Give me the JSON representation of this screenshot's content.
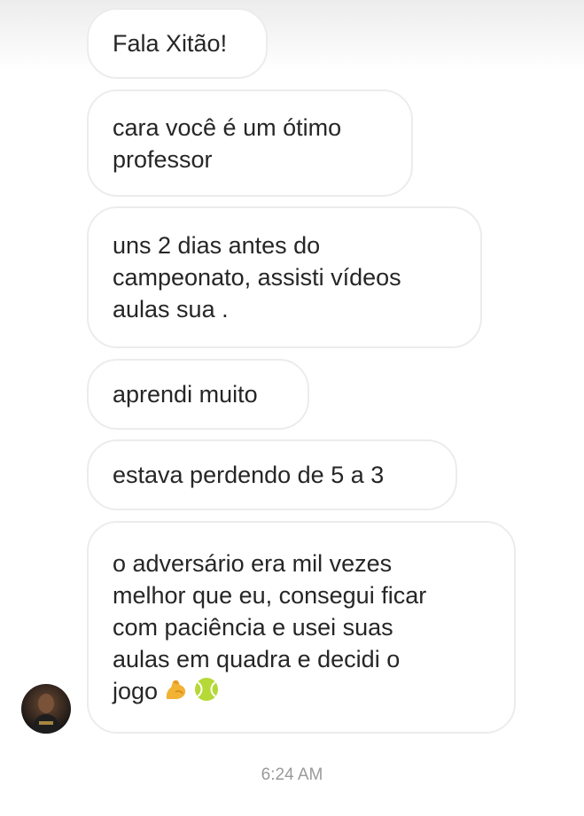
{
  "conversation": {
    "messages": [
      {
        "text": "Fala Xitão!"
      },
      {
        "text": "cara você é um ótimo\nprofessor"
      },
      {
        "text": "uns 2 dias antes do\ncampeonato, assisti vídeos\naulas sua ."
      },
      {
        "text": "aprendi muito"
      },
      {
        "text": "estava perdendo de 5 a 3"
      },
      {
        "text": "o adversário era mil vezes\nmelhor que eu, consegui ficar\ncom paciência e usei suas\naulas em quadra e decidi o\njogo",
        "emojis": [
          "flexed-biceps-emoji",
          "tennis-ball-emoji"
        ]
      }
    ],
    "timestamp": "6:24 AM",
    "sender_avatar": "avatar-photo",
    "colors": {
      "bubble_border": "#ececec",
      "text": "#262626",
      "timestamp": "#9a9a9a"
    }
  }
}
